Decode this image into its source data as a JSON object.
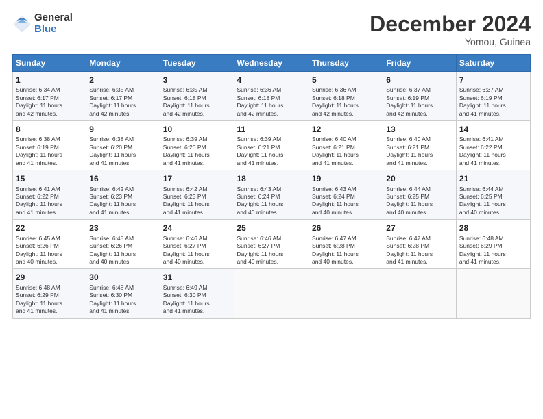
{
  "header": {
    "logo_general": "General",
    "logo_blue": "Blue",
    "month_title": "December 2024",
    "location": "Yomou, Guinea"
  },
  "weekdays": [
    "Sunday",
    "Monday",
    "Tuesday",
    "Wednesday",
    "Thursday",
    "Friday",
    "Saturday"
  ],
  "weeks": [
    [
      {
        "day": "1",
        "info": "Sunrise: 6:34 AM\nSunset: 6:17 PM\nDaylight: 11 hours\nand 42 minutes."
      },
      {
        "day": "2",
        "info": "Sunrise: 6:35 AM\nSunset: 6:17 PM\nDaylight: 11 hours\nand 42 minutes."
      },
      {
        "day": "3",
        "info": "Sunrise: 6:35 AM\nSunset: 6:18 PM\nDaylight: 11 hours\nand 42 minutes."
      },
      {
        "day": "4",
        "info": "Sunrise: 6:36 AM\nSunset: 6:18 PM\nDaylight: 11 hours\nand 42 minutes."
      },
      {
        "day": "5",
        "info": "Sunrise: 6:36 AM\nSunset: 6:18 PM\nDaylight: 11 hours\nand 42 minutes."
      },
      {
        "day": "6",
        "info": "Sunrise: 6:37 AM\nSunset: 6:19 PM\nDaylight: 11 hours\nand 42 minutes."
      },
      {
        "day": "7",
        "info": "Sunrise: 6:37 AM\nSunset: 6:19 PM\nDaylight: 11 hours\nand 41 minutes."
      }
    ],
    [
      {
        "day": "8",
        "info": "Sunrise: 6:38 AM\nSunset: 6:19 PM\nDaylight: 11 hours\nand 41 minutes."
      },
      {
        "day": "9",
        "info": "Sunrise: 6:38 AM\nSunset: 6:20 PM\nDaylight: 11 hours\nand 41 minutes."
      },
      {
        "day": "10",
        "info": "Sunrise: 6:39 AM\nSunset: 6:20 PM\nDaylight: 11 hours\nand 41 minutes."
      },
      {
        "day": "11",
        "info": "Sunrise: 6:39 AM\nSunset: 6:21 PM\nDaylight: 11 hours\nand 41 minutes."
      },
      {
        "day": "12",
        "info": "Sunrise: 6:40 AM\nSunset: 6:21 PM\nDaylight: 11 hours\nand 41 minutes."
      },
      {
        "day": "13",
        "info": "Sunrise: 6:40 AM\nSunset: 6:21 PM\nDaylight: 11 hours\nand 41 minutes."
      },
      {
        "day": "14",
        "info": "Sunrise: 6:41 AM\nSunset: 6:22 PM\nDaylight: 11 hours\nand 41 minutes."
      }
    ],
    [
      {
        "day": "15",
        "info": "Sunrise: 6:41 AM\nSunset: 6:22 PM\nDaylight: 11 hours\nand 41 minutes."
      },
      {
        "day": "16",
        "info": "Sunrise: 6:42 AM\nSunset: 6:23 PM\nDaylight: 11 hours\nand 41 minutes."
      },
      {
        "day": "17",
        "info": "Sunrise: 6:42 AM\nSunset: 6:23 PM\nDaylight: 11 hours\nand 41 minutes."
      },
      {
        "day": "18",
        "info": "Sunrise: 6:43 AM\nSunset: 6:24 PM\nDaylight: 11 hours\nand 40 minutes."
      },
      {
        "day": "19",
        "info": "Sunrise: 6:43 AM\nSunset: 6:24 PM\nDaylight: 11 hours\nand 40 minutes."
      },
      {
        "day": "20",
        "info": "Sunrise: 6:44 AM\nSunset: 6:25 PM\nDaylight: 11 hours\nand 40 minutes."
      },
      {
        "day": "21",
        "info": "Sunrise: 6:44 AM\nSunset: 6:25 PM\nDaylight: 11 hours\nand 40 minutes."
      }
    ],
    [
      {
        "day": "22",
        "info": "Sunrise: 6:45 AM\nSunset: 6:26 PM\nDaylight: 11 hours\nand 40 minutes."
      },
      {
        "day": "23",
        "info": "Sunrise: 6:45 AM\nSunset: 6:26 PM\nDaylight: 11 hours\nand 40 minutes."
      },
      {
        "day": "24",
        "info": "Sunrise: 6:46 AM\nSunset: 6:27 PM\nDaylight: 11 hours\nand 40 minutes."
      },
      {
        "day": "25",
        "info": "Sunrise: 6:46 AM\nSunset: 6:27 PM\nDaylight: 11 hours\nand 40 minutes."
      },
      {
        "day": "26",
        "info": "Sunrise: 6:47 AM\nSunset: 6:28 PM\nDaylight: 11 hours\nand 40 minutes."
      },
      {
        "day": "27",
        "info": "Sunrise: 6:47 AM\nSunset: 6:28 PM\nDaylight: 11 hours\nand 41 minutes."
      },
      {
        "day": "28",
        "info": "Sunrise: 6:48 AM\nSunset: 6:29 PM\nDaylight: 11 hours\nand 41 minutes."
      }
    ],
    [
      {
        "day": "29",
        "info": "Sunrise: 6:48 AM\nSunset: 6:29 PM\nDaylight: 11 hours\nand 41 minutes."
      },
      {
        "day": "30",
        "info": "Sunrise: 6:48 AM\nSunset: 6:30 PM\nDaylight: 11 hours\nand 41 minutes."
      },
      {
        "day": "31",
        "info": "Sunrise: 6:49 AM\nSunset: 6:30 PM\nDaylight: 11 hours\nand 41 minutes."
      },
      null,
      null,
      null,
      null
    ]
  ]
}
